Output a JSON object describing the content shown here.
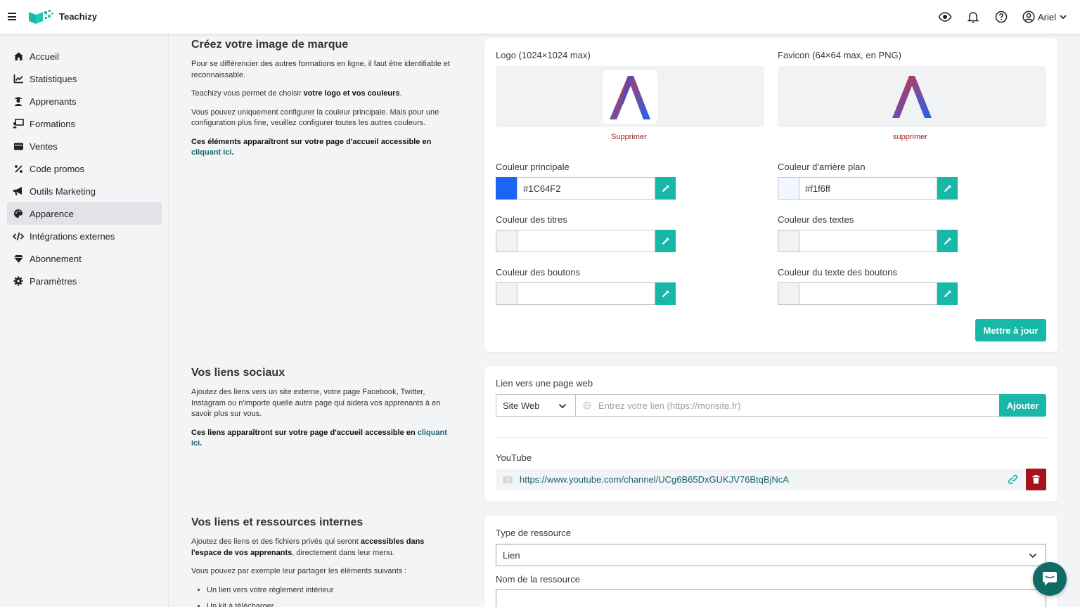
{
  "app": {
    "name": "Teachizy"
  },
  "header": {
    "user_name": "Ariel"
  },
  "sidebar": {
    "items": [
      {
        "label": "Accueil",
        "icon": "home-icon"
      },
      {
        "label": "Statistiques",
        "icon": "chart-line-icon"
      },
      {
        "label": "Apprenants",
        "icon": "graduate-icon"
      },
      {
        "label": "Formations",
        "icon": "chalkboard-icon"
      },
      {
        "label": "Ventes",
        "icon": "wallet-icon"
      },
      {
        "label": "Code promos",
        "icon": "percent-icon"
      },
      {
        "label": "Outils Marketing",
        "icon": "bullhorn-icon"
      },
      {
        "label": "Apparence",
        "icon": "palette-icon",
        "active": true
      },
      {
        "label": "Intégrations externes",
        "icon": "code-icon"
      },
      {
        "label": "Abonnement",
        "icon": "gem-icon"
      },
      {
        "label": "Paramètres",
        "icon": "gear-icon"
      }
    ]
  },
  "branding": {
    "title": "Créez votre image de marque",
    "p1": "Pour se différencier des autres formations en ligne, il faut être identifiable et reconnaissable.",
    "p2_prefix": "Teachizy vous permet de choisir ",
    "p2_bold": "votre logo et vos couleurs",
    "p2_suffix": ".",
    "p3": "Vous pouvez uniquement configurer la couleur principale. Mais pour une configuration plus fine, veuillez configurer toutes les autres couleurs.",
    "p4_bold": "Ces éléments apparaîtront sur votre page d'accueil accessible en ",
    "p4_link": "cliquant ici",
    "p4_end": ".",
    "logo_label": "Logo (1024×1024 max)",
    "favicon_label": "Favicon (64×64 max, en PNG)",
    "logo_delete": "Supprimer",
    "favicon_delete": "supprimer",
    "colors": [
      {
        "label": "Couleur principale",
        "value": "#1C64F2",
        "swatch": "#1c64f2"
      },
      {
        "label": "Couleur d'arrière plan",
        "value": "#f1f6ff",
        "swatch": "#f1f6ff"
      },
      {
        "label": "Couleur des titres",
        "value": "",
        "swatch": "#f1f2f3"
      },
      {
        "label": "Couleur des textes",
        "value": "",
        "swatch": "#f1f2f3"
      },
      {
        "label": "Couleur des boutons",
        "value": "",
        "swatch": "#f1f2f3"
      },
      {
        "label": "Couleur du texte des boutons",
        "value": "",
        "swatch": "#f1f2f3"
      }
    ],
    "update_button": "Mettre à jour"
  },
  "social": {
    "title": "Vos liens sociaux",
    "p1": "Ajoutez des liens vers un site externe, votre page Facebook, Twitter, Instagram ou n'importe quelle autre page qui aidera vos apprenants à en savoir plus sur vous.",
    "p2_bold": "Ces liens apparaîtront sur votre page d'accueil accessible en ",
    "p2_link": "cliquant ici",
    "p2_end": ".",
    "link_label": "Lien vers une page web",
    "select_value": "Site Web",
    "url_placeholder": "Entrez votre lien (https://monsite.fr)",
    "add_button": "Ajouter",
    "existing_label": "YouTube",
    "existing_url": "https://www.youtube.com/channel/UCg6B65DxGUKJV76BtqBjNcA"
  },
  "internal": {
    "title": "Vos liens et ressources internes",
    "p1_prefix": "Ajoutez des liens et des fichiers privés qui seront ",
    "p1_bold": "accessibles dans l'espace de vos apprenants",
    "p1_suffix": ", directement dans leur menu.",
    "p2": "Vous pouvez par exemple leur partager les éléments suivants :",
    "bullets": [
      "Un lien vers votre règlement intérieur",
      "Un kit à télécharger"
    ],
    "type_label": "Type de ressource",
    "type_value": "Lien",
    "name_label": "Nom de la ressource"
  },
  "colors": {
    "accent": "#17b8a8",
    "danger": "#9c1b1b",
    "link": "#18656f"
  }
}
